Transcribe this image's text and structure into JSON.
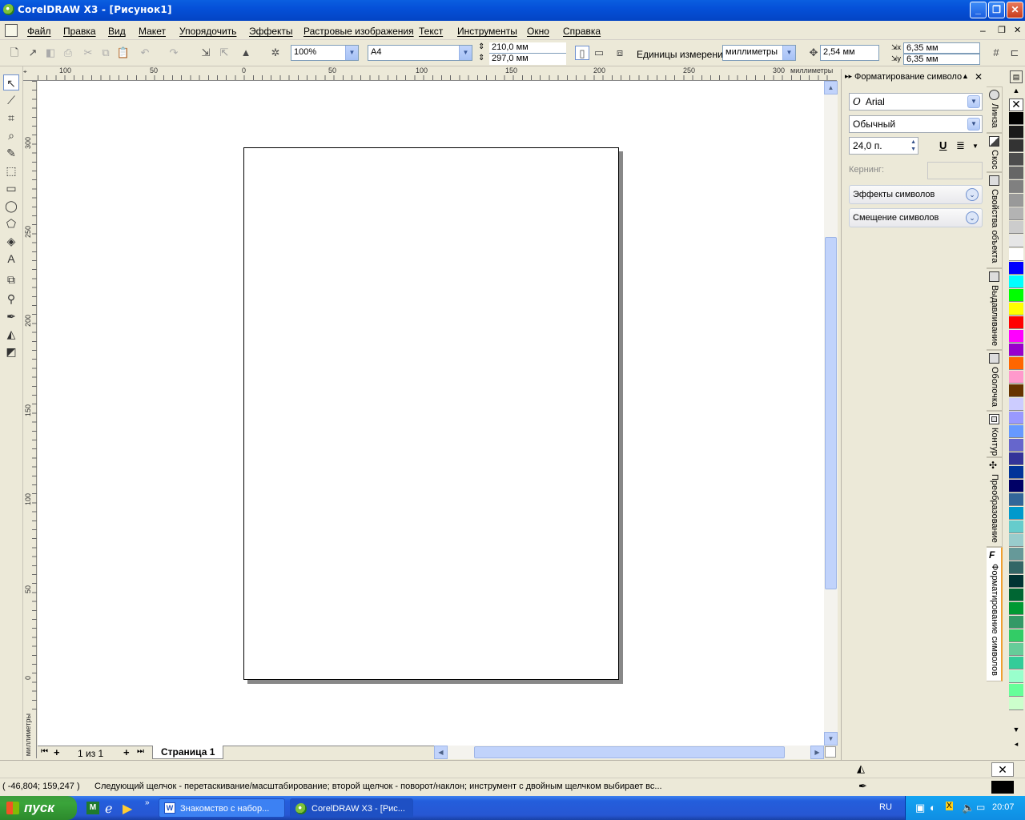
{
  "window": {
    "title": "CorelDRAW X3 - [Рисунок1]",
    "buttons": {
      "minimize": "_",
      "restore": "❐",
      "close": "✕"
    }
  },
  "menu": {
    "items": [
      "Файл",
      "Правка",
      "Вид",
      "Макет",
      "Упорядочить",
      "Эффекты",
      "Растровые изображения",
      "Текст",
      "Инструменты",
      "Окно",
      "Справка"
    ]
  },
  "toolbar": {
    "zoom": "100%",
    "paper_size": "A4",
    "width": "210,0 мм",
    "height": "297,0 мм",
    "units_label": "Единицы измерения:",
    "units_value": "миллиметры",
    "nudge": "2,54 мм",
    "dup_x": "6,35 мм",
    "dup_y": "6,35 мм"
  },
  "ruler": {
    "h_ticks": [
      "100",
      "50",
      "0",
      "50",
      "100",
      "150",
      "200",
      "250",
      "300",
      "миллиметры"
    ],
    "v_ticks": [
      "300",
      "250",
      "200",
      "150",
      "100",
      "50",
      "0",
      "миллиметры"
    ]
  },
  "pagenav": {
    "counter": "1 из 1",
    "page_tab": "Страница 1"
  },
  "docker": {
    "title": "Форматирование символо",
    "font": "Arial",
    "style": "Обычный",
    "size": "24,0 п.",
    "kerning_label": "Кернинг:",
    "effects_label": "Эффекты символов",
    "shift_label": "Смещение символов"
  },
  "vtabs": [
    "Линза",
    "Скос",
    "Свойства объекта",
    "Выдавливание",
    "Оболочка",
    "Контур",
    "Преобразование",
    "Форматирование символов"
  ],
  "palette": {
    "colors": [
      "#000000",
      "#1a1a1a",
      "#333333",
      "#4d4d4d",
      "#666666",
      "#808080",
      "#999999",
      "#b3b3b3",
      "#cccccc",
      "#e6e6e6",
      "#ffffff",
      "#0000ff",
      "#00ffff",
      "#00ff00",
      "#ffff00",
      "#ff0000",
      "#ff00ff",
      "#9900cc",
      "#ff6600",
      "#ff99cc",
      "#663300",
      "#ccccff",
      "#9999ff",
      "#6699ff",
      "#6666cc",
      "#333399",
      "#003399",
      "#000066",
      "#336699",
      "#0099cc",
      "#66cccc",
      "#99cccc",
      "#669999",
      "#336666",
      "#003333",
      "#006633",
      "#009933",
      "#339966",
      "#33cc66",
      "#66cc99",
      "#33cc99",
      "#99ffcc",
      "#66ff99",
      "#ccffcc"
    ]
  },
  "status": {
    "coords": "( -46,804; 159,247 )",
    "hint": "Следующий щелчок - перетаскивание/масштабирование; второй щелчок - поворот/наклон; инструмент с двойным щелчком выбирает вс..."
  },
  "taskbar": {
    "start": "пуск",
    "tasks": [
      "Знакомство с набор...",
      "CorelDRAW X3 - [Рис..."
    ],
    "lang": "RU",
    "time": "20:07"
  }
}
